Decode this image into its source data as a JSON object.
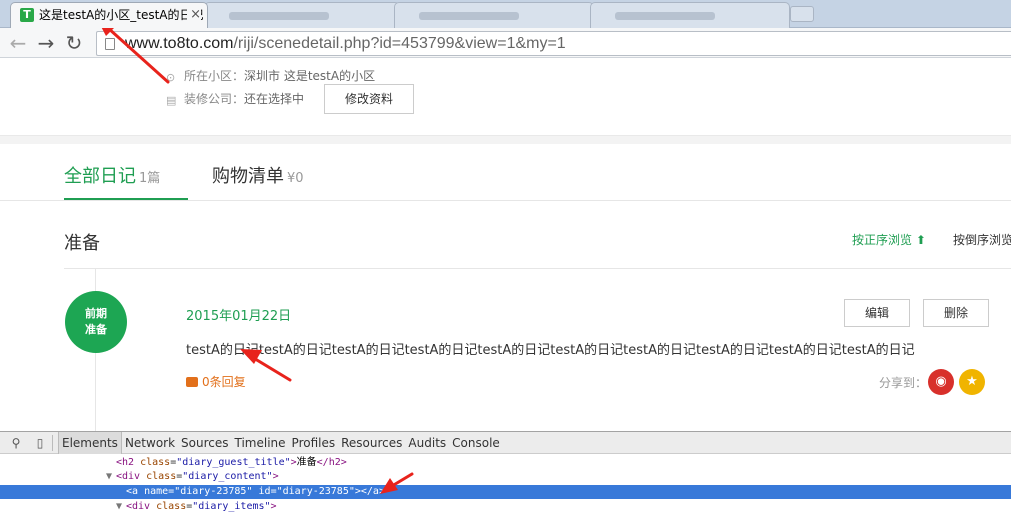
{
  "browser": {
    "active_tab": {
      "favicon": "T",
      "title": "这是testA的小区_testA的日记",
      "close": "×"
    },
    "url_host": "www.to8to.com",
    "url_path": "/riji/scenedetail.php?id=453799&view=1&my=1"
  },
  "profile": {
    "community_label": "所在小区：",
    "community_value": "深圳市 这是testA的小区",
    "company_label": "装修公司：",
    "company_value": "还在选择中",
    "edit_button": "修改资料"
  },
  "tabs": [
    {
      "label": "全部日记",
      "count": "1篇"
    },
    {
      "label": "购物清单",
      "count": "¥0"
    }
  ],
  "stage": {
    "title": "准备",
    "sort_asc": "按正序浏览 ⬆",
    "sort_desc": "按倒序浏览"
  },
  "entry": {
    "badge_line1": "前期",
    "badge_line2": "准备",
    "date": "2015年01月22日",
    "edit": "编辑",
    "delete": "删除",
    "text": "testA的日记testA的日记testA的日记testA的日记testA的日记testA的日记testA的日记testA的日记testA的日记testA的日记",
    "comments": "0条回复",
    "share_label": "分享到："
  },
  "devtools": {
    "tabs": [
      "Elements",
      "Network",
      "Sources",
      "Timeline",
      "Profiles",
      "Resources",
      "Audits",
      "Console"
    ],
    "active_tab": "Elements"
  },
  "colors": {
    "accent_green": "#1f9e52",
    "comment_orange": "#e2701b",
    "weibo_red": "#d8302b",
    "qzone_yellow": "#f0b400",
    "selection_blue": "#3879d9",
    "annotation_red": "#e8231c"
  }
}
